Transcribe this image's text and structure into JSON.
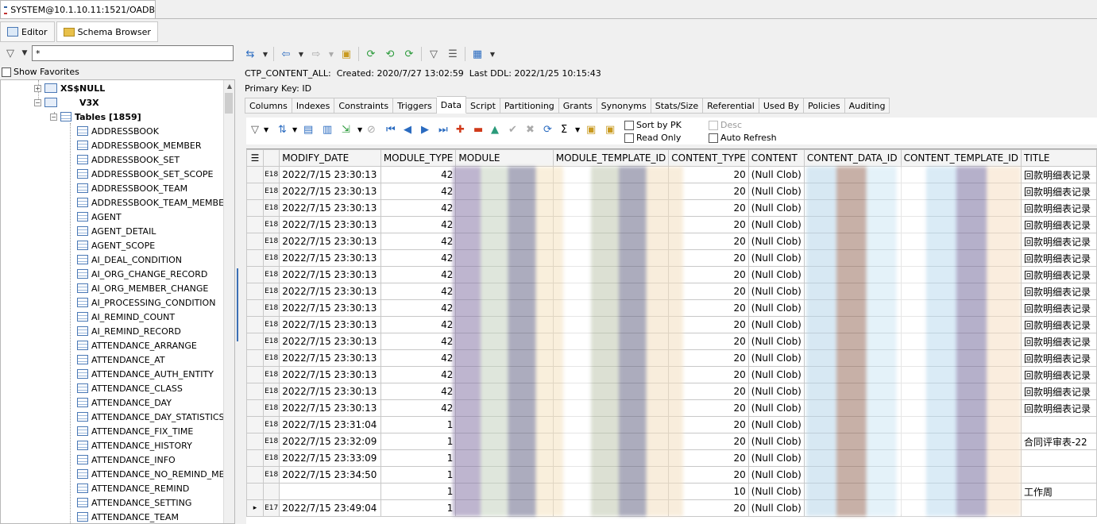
{
  "window": {
    "title": "SYSTEM@10.1.10.11:1521/OADB"
  },
  "subtabs": [
    {
      "label": "Editor"
    },
    {
      "label": "Schema Browser"
    }
  ],
  "left": {
    "filter_value": "*",
    "show_favorites_label": "Show Favorites",
    "tree": {
      "schema1": "XS$NULL",
      "schema2": "V3X",
      "tables_node": "Tables [1859]",
      "tables": [
        "ADDRESSBOOK",
        "ADDRESSBOOK_MEMBER",
        "ADDRESSBOOK_SET",
        "ADDRESSBOOK_SET_SCOPE",
        "ADDRESSBOOK_TEAM",
        "ADDRESSBOOK_TEAM_MEMBERS",
        "AGENT",
        "AGENT_DETAIL",
        "AGENT_SCOPE",
        "AI_DEAL_CONDITION",
        "AI_ORG_CHANGE_RECORD",
        "AI_ORG_MEMBER_CHANGE",
        "AI_PROCESSING_CONDITION",
        "AI_REMIND_COUNT",
        "AI_REMIND_RECORD",
        "ATTENDANCE_ARRANGE",
        "ATTENDANCE_AT",
        "ATTENDANCE_AUTH_ENTITY",
        "ATTENDANCE_CLASS",
        "ATTENDANCE_DAY",
        "ATTENDANCE_DAY_STATISTICS",
        "ATTENDANCE_FIX_TIME",
        "ATTENDANCE_HISTORY",
        "ATTENDANCE_INFO",
        "ATTENDANCE_NO_REMIND_MEM",
        "ATTENDANCE_REMIND",
        "ATTENDANCE_SETTING",
        "ATTENDANCE_TEAM"
      ]
    }
  },
  "right": {
    "info": {
      "object": "CTP_CONTENT_ALL:",
      "created": "Created: 2020/7/27 13:02:59",
      "last_ddl": "Last DDL: 2022/1/25 10:15:43",
      "primary_key": "Primary Key:  ID"
    },
    "tabs": [
      "Columns",
      "Indexes",
      "Constraints",
      "Triggers",
      "Data",
      "Script",
      "Partitioning",
      "Grants",
      "Synonyms",
      "Stats/Size",
      "Referential",
      "Used By",
      "Policies",
      "Auditing"
    ],
    "options": {
      "sort_by_pk": "Sort by PK",
      "read_only": "Read Only",
      "desc": "Desc",
      "auto_refresh": "Auto Refresh"
    },
    "grid": {
      "columns": [
        "MODIFY_DATE",
        "MODULE_TYPE",
        "MODULE",
        "MODULE_TEMPLATE_ID",
        "CONTENT_TYPE",
        "CONTENT",
        "CONTENT_DATA_ID",
        "CONTENT_TEMPLATE_ID",
        "TITLE"
      ],
      "rows": [
        {
          "ind": "E18",
          "date": "2022/7/15 23:30:13",
          "mtype": "42",
          "ctype": "20",
          "content": "(Null Clob)",
          "title": "回款明细表记录"
        },
        {
          "ind": "E18",
          "date": "2022/7/15 23:30:13",
          "mtype": "42",
          "ctype": "20",
          "content": "(Null Clob)",
          "title": "回款明细表记录"
        },
        {
          "ind": "E18",
          "date": "2022/7/15 23:30:13",
          "mtype": "42",
          "ctype": "20",
          "content": "(Null Clob)",
          "title": "回款明细表记录"
        },
        {
          "ind": "E18",
          "date": "2022/7/15 23:30:13",
          "mtype": "42",
          "ctype": "20",
          "content": "(Null Clob)",
          "title": "回款明细表记录"
        },
        {
          "ind": "E18",
          "date": "2022/7/15 23:30:13",
          "mtype": "42",
          "ctype": "20",
          "content": "(Null Clob)",
          "title": "回款明细表记录"
        },
        {
          "ind": "E18",
          "date": "2022/7/15 23:30:13",
          "mtype": "42",
          "ctype": "20",
          "content": "(Null Clob)",
          "title": "回款明细表记录"
        },
        {
          "ind": "E18",
          "date": "2022/7/15 23:30:13",
          "mtype": "42",
          "ctype": "20",
          "content": "(Null Clob)",
          "title": "回款明细表记录"
        },
        {
          "ind": "E18",
          "date": "2022/7/15 23:30:13",
          "mtype": "42",
          "ctype": "20",
          "content": "(Null Clob)",
          "title": "回款明细表记录"
        },
        {
          "ind": "E18",
          "date": "2022/7/15 23:30:13",
          "mtype": "42",
          "ctype": "20",
          "content": "(Null Clob)",
          "title": "回款明细表记录"
        },
        {
          "ind": "E18",
          "date": "2022/7/15 23:30:13",
          "mtype": "42",
          "ctype": "20",
          "content": "(Null Clob)",
          "title": "回款明细表记录"
        },
        {
          "ind": "E18",
          "date": "2022/7/15 23:30:13",
          "mtype": "42",
          "ctype": "20",
          "content": "(Null Clob)",
          "title": "回款明细表记录"
        },
        {
          "ind": "E18",
          "date": "2022/7/15 23:30:13",
          "mtype": "42",
          "ctype": "20",
          "content": "(Null Clob)",
          "title": "回款明细表记录"
        },
        {
          "ind": "E18",
          "date": "2022/7/15 23:30:13",
          "mtype": "42",
          "ctype": "20",
          "content": "(Null Clob)",
          "title": "回款明细表记录"
        },
        {
          "ind": "E18",
          "date": "2022/7/15 23:30:13",
          "mtype": "42",
          "ctype": "20",
          "content": "(Null Clob)",
          "title": "回款明细表记录"
        },
        {
          "ind": "E18",
          "date": "2022/7/15 23:30:13",
          "mtype": "42",
          "ctype": "20",
          "content": "(Null Clob)",
          "title": "回款明细表记录"
        },
        {
          "ind": "E18",
          "date": "2022/7/15 23:31:04",
          "mtype": "1",
          "ctype": "20",
          "content": "(Null Clob)",
          "title": ""
        },
        {
          "ind": "E18",
          "date": "2022/7/15 23:32:09",
          "mtype": "1",
          "ctype": "20",
          "content": "(Null Clob)",
          "title": "合同评审表-22"
        },
        {
          "ind": "E18",
          "date": "2022/7/15 23:33:09",
          "mtype": "1",
          "ctype": "20",
          "content": "(Null Clob)",
          "title": ""
        },
        {
          "ind": "E18",
          "date": "2022/7/15 23:34:50",
          "mtype": "1",
          "ctype": "20",
          "content": "(Null Clob)",
          "title": ""
        },
        {
          "ind": "",
          "date": "",
          "mtype": "1",
          "ctype": "10",
          "content": "(Null Clob)",
          "title": "工作周"
        },
        {
          "ind": "E17",
          "date": "2022/7/15 23:49:04",
          "mtype": "1",
          "ctype": "20",
          "content": "(Null Clob)",
          "title": ""
        }
      ]
    }
  }
}
